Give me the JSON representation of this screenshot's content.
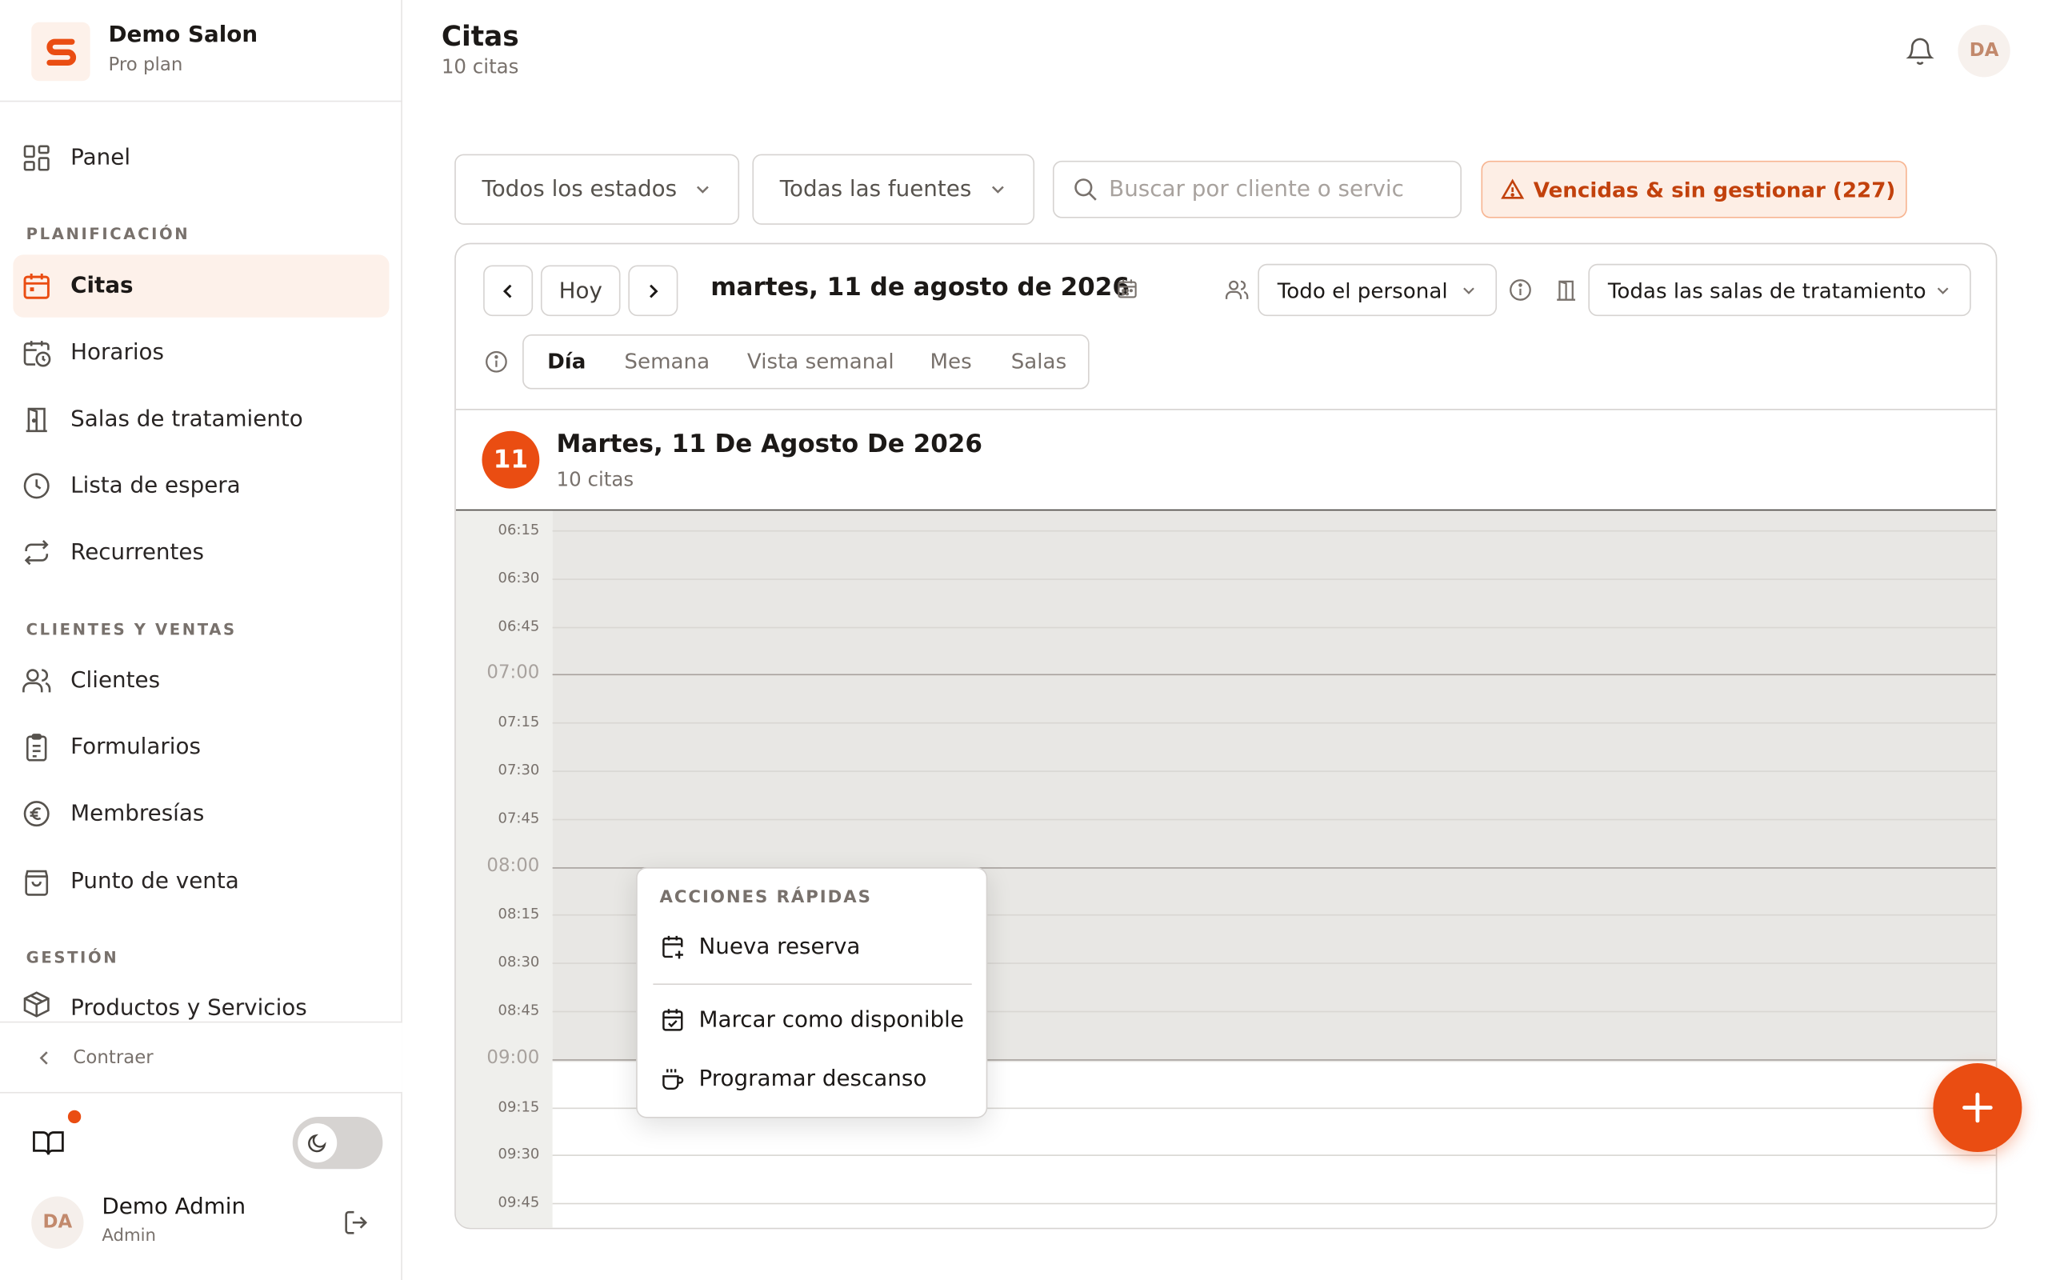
{
  "brand": {
    "name": "Demo Salon",
    "plan": "Pro plan"
  },
  "sidebar": {
    "panel": "Panel",
    "sections": {
      "planning": "PLANIFICACIÓN",
      "clients": "CLIENTES Y VENTAS",
      "management": "GESTIÓN"
    },
    "items": {
      "citas": "Citas",
      "horarios": "Horarios",
      "salas": "Salas de tratamiento",
      "espera": "Lista de espera",
      "recurrentes": "Recurrentes",
      "clientes": "Clientes",
      "formularios": "Formularios",
      "membresias": "Membresías",
      "pos": "Punto de venta",
      "productos": "Productos y Servicios"
    },
    "collapse": "Contraer",
    "user": {
      "initials": "DA",
      "name": "Demo Admin",
      "role": "Admin"
    }
  },
  "header": {
    "title": "Citas",
    "subtitle": "10 citas",
    "avatar": "DA"
  },
  "filters": {
    "status": "Todos los estados",
    "source": "Todas las fuentes",
    "search_placeholder": "Buscar por cliente o servicio",
    "overdue": "Vencidas & sin gestionar (227)"
  },
  "calendar": {
    "today": "Hoy",
    "date": "martes, 11 de agosto de 2026",
    "staff": "Todo el personal",
    "rooms": "Todas las salas de tratamiento",
    "views": [
      "Día",
      "Semana",
      "Vista semanal",
      "Mes",
      "Salas"
    ],
    "active_view": "Día",
    "day_number": "11",
    "day_title": "Martes, 11 De Agosto De 2026",
    "day_count": "10 citas",
    "slots": [
      "06:15",
      "06:30",
      "06:45",
      "07:00",
      "07:15",
      "07:30",
      "07:45",
      "08:00",
      "08:15",
      "08:30",
      "08:45",
      "09:00",
      "09:15",
      "09:30",
      "09:45"
    ]
  },
  "quick_actions": {
    "label": "ACCIONES RÁPIDAS",
    "new_booking": "Nueva reserva",
    "mark_available": "Marcar como disponible",
    "schedule_break": "Programar descanso"
  },
  "colors": {
    "accent": "#ea4d12",
    "accent_soft": "#fdf1ea",
    "unavailable": "#e8e7e4"
  }
}
